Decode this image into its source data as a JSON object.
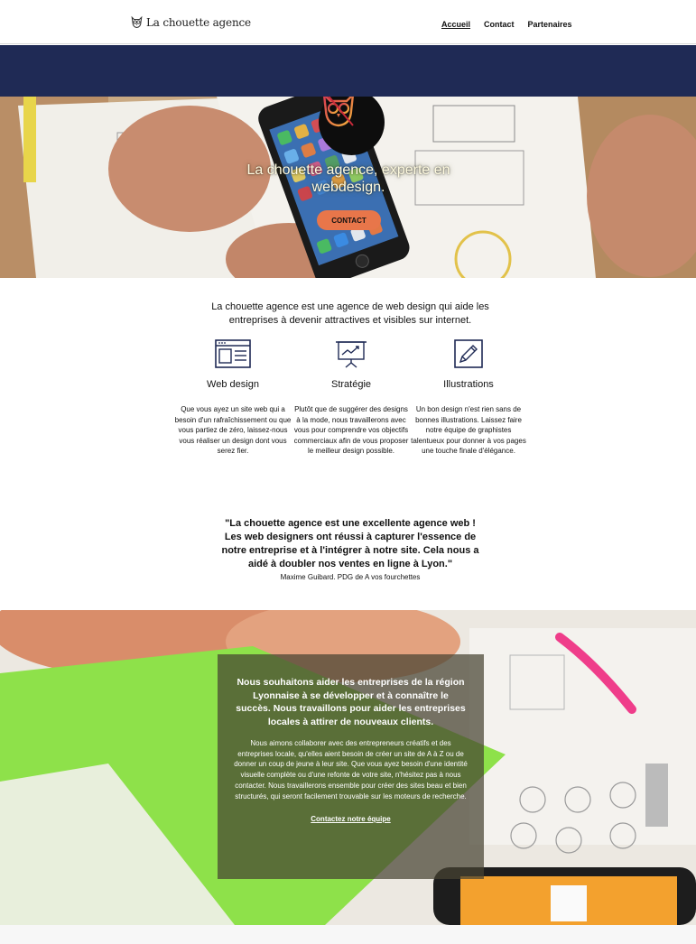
{
  "header": {
    "logo_text": "La chouette agence",
    "logo_icon": "owl-icon",
    "nav": [
      {
        "label": "Accueil",
        "active": true
      },
      {
        "label": "Contact",
        "active": false
      },
      {
        "label": "Partenaires",
        "active": false
      }
    ]
  },
  "colors": {
    "navy": "#1f2a55",
    "accent": "#e8764a",
    "overlay": "#46423299"
  },
  "hero": {
    "title": "La chouette agence, experte en webdesign.",
    "button_label": "CONTACT",
    "badge_icon": "owl-badge-icon"
  },
  "intro": {
    "text": "La chouette agence est une agence de web design qui aide les entreprises à devenir attractives et visibles sur internet."
  },
  "services": [
    {
      "icon": "webpage-layout-icon",
      "title": "Web design",
      "text": "Que vous ayez un site web qui a besoin d'un rafraîchissement ou que vous partiez de zéro, laissez-nous vous réaliser un design dont vous serez fier."
    },
    {
      "icon": "presentation-chart-icon",
      "title": "Stratégie",
      "text": "Plutôt que de suggérer des designs à la mode, nous travaillerons avec vous pour comprendre vos objectifs commerciaux afin de vous proposer le meilleur design possible."
    },
    {
      "icon": "pencil-icon",
      "title": "Illustrations",
      "text": "Un bon design n'est rien sans de bonnes illustrations. Laissez faire notre équipe de graphistes talentueux pour donner à vos pages une touche finale d'élégance."
    }
  ],
  "testimonial": {
    "quote": "\"La chouette agence est une excellente agence web ! Les web designers ont réussi à capturer l'essence de notre entreprise et à l'intégrer à notre site. Cela nous a aidé à doubler nos ventes en ligne à Lyon.\"",
    "author": "Maxime Guibard. PDG de A vos fourchettes"
  },
  "about": {
    "heading": "Nous souhaitons aider les entreprises de la région Lyonnaise à se développer et à connaître le succès. Nous travaillons pour aider les entreprises locales à attirer de nouveaux clients.",
    "text": "Nous aimons collaborer avec des entrepreneurs créatifs et des entreprises locale, qu'elles aient besoin de créer un site de A à Z ou de donner un coup de jeune à leur site. Que vous ayez besoin d'une identité visuelle complète ou d'une refonte de votre site, n'hésitez pas à nous contacter. Nous travaillerons ensemble pour créer des sites beau et bien structurés, qui seront facilement trouvable sur les moteurs de recherche.",
    "link_label": "Contactez notre équipe"
  }
}
